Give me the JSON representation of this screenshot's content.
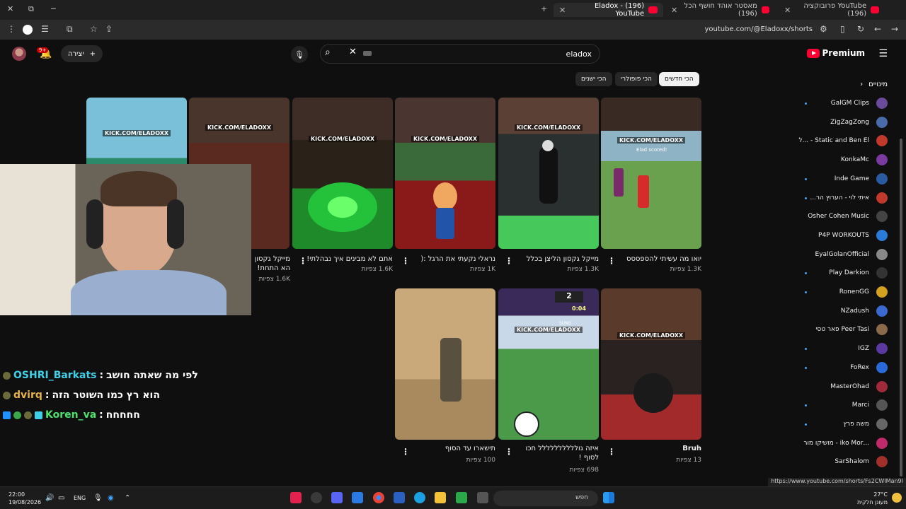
{
  "browser": {
    "tabs": [
      {
        "title": "YouTube פרובוקציה (196)"
      },
      {
        "title": "מאסטר אוהד חושף הכל (196)"
      },
      {
        "title": "(196) Eladox - YouTube"
      }
    ],
    "url": "youtube.com/@Eladoxx/shorts"
  },
  "header": {
    "notification_count": "9+",
    "create_label": "יצירה",
    "search_value": "eladox",
    "logo_text": "Premium"
  },
  "sort_chips": [
    "הכי חדשים",
    "הכי פופולרי",
    "הכי ישנים"
  ],
  "watermark": "KICK.COM/ELADOXX",
  "videos": [
    {
      "title": "יואו מה עשיתי להספססס",
      "views": "1.3K צפיות"
    },
    {
      "title": "מייקל גקסון הליצן בכלל",
      "views": "1.3K צפיות"
    },
    {
      "title": "נראלי נקעתי את הרגל :(",
      "views": "1K צפיות"
    },
    {
      "title": "אתם לא מבינים איך נבהלתי!",
      "views": "1.6K צפיות"
    },
    {
      "title": "מייקל גקסון הא התחת!",
      "views": "1.6K צפיות"
    },
    {
      "title": "Bruh",
      "views": "13 צפיות"
    },
    {
      "title": "איזה גולללללללללל חכו לסוף !",
      "views": "698 צפיות"
    },
    {
      "title": "תישארו עד הסוף",
      "views": "100 צפיות"
    }
  ],
  "thumb_text": {
    "elad_scored": "Elad scored!",
    "score": "2",
    "timer": "0:04",
    "sung": "SUNG"
  },
  "chat": [
    {
      "user": "OSHRI_Barkats",
      "message": "לפי מה שאתה חושב",
      "color": "#3fd0e8"
    },
    {
      "user": "dvirq",
      "message": "הוא רץ כמו השוטר הזה",
      "color": "#e8b24a"
    },
    {
      "user": "Koren_va",
      "message": "חחחחח",
      "color": "#4ce36a"
    }
  ],
  "sidebar": {
    "header": "מינויים",
    "subscriptions": [
      "GalGM Clips",
      "ZigZagZong",
      "Static and Ben El - ...ל",
      "KonkaMc",
      "Inde Game",
      "איתי לוי - הערוץ הר...",
      "Osher Cohen Music",
      "P4P WORKOUTS",
      "EyalGolanOfficial",
      "Play Darkion",
      "RonenGG",
      "NZadush",
      "Peer Tasi פאר טסי",
      "IGZ",
      "FoRex",
      "MasterOhad",
      "Marci",
      "משה פרץ",
      "...iko Mor - מושיקו מור",
      "SarShalom"
    ]
  },
  "status_link": "https://www.youtube.com/shorts/Fs2CWIMan9I",
  "taskbar": {
    "time": "22:00",
    "date": "19/08/2026",
    "lang": "ENG",
    "search": "חפש",
    "temp": "27°C",
    "weather": "מעונן חלקית"
  }
}
